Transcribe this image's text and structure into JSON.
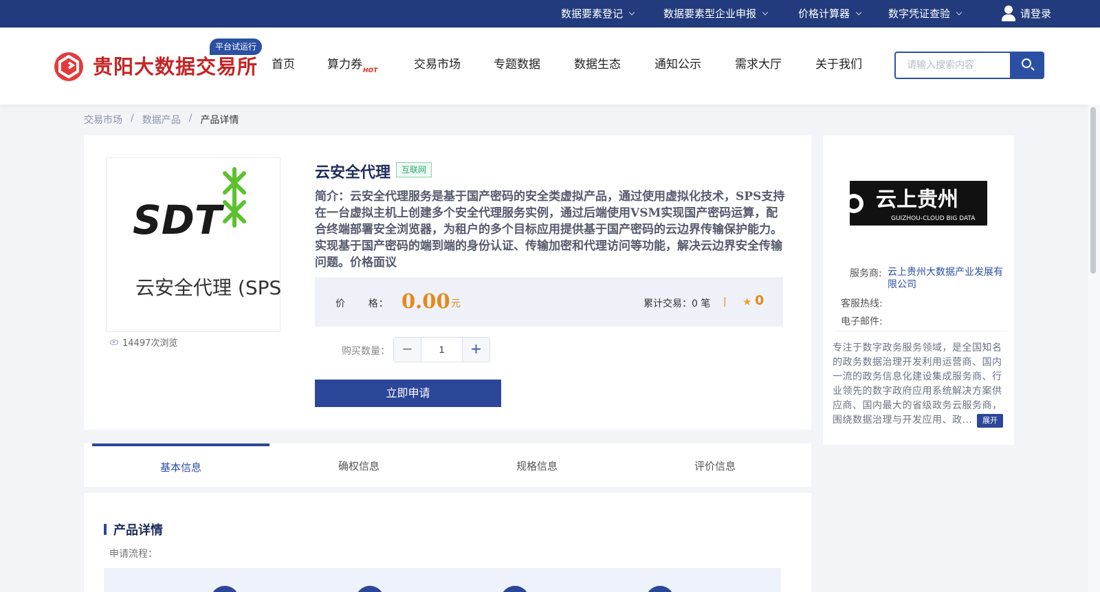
{
  "topbar": {
    "items": [
      {
        "label": "数据要素登记"
      },
      {
        "label": "数据要素型企业申报"
      },
      {
        "label": "价格计算器"
      },
      {
        "label": "数字凭证查验"
      }
    ],
    "login": "请登录"
  },
  "header": {
    "site_name": "贵阳大数据交易所",
    "trial_badge": "平台试运行",
    "nav": [
      {
        "label": "首页"
      },
      {
        "label": "算力券",
        "hot": "HOT"
      },
      {
        "label": "交易市场"
      },
      {
        "label": "专题数据"
      },
      {
        "label": "数据生态"
      },
      {
        "label": "通知公示"
      },
      {
        "label": "需求大厅"
      },
      {
        "label": "关于我们"
      }
    ],
    "search_placeholder": "请输入搜索内容"
  },
  "breadcrumb": {
    "items": [
      "交易市场",
      "数据产品",
      "产品详情"
    ],
    "separator": "/"
  },
  "product": {
    "image_brand": "SDT",
    "image_caption": "云安全代理 (SPS)",
    "views": "14497次浏览",
    "title": "云安全代理",
    "tag": "互联网",
    "description": "简介：云安全代理服务是基于国产密码的安全类虚拟产品，通过使用虚拟化技术，SPS支持在一台虚拟主机上创建多个安全代理服务实例，通过后端使用VSM实现国产密码运算，配合终端部署安全浏览器，为租户的多个目标应用提供基于国产密码的云边界传输保护能力。实现基于国产密码的端到端的身份认证、传输加密和代理访问等功能，解决云边界安全传输问题。价格面议",
    "price_label": "价      格：",
    "price": "0.00",
    "price_unit": "元",
    "trade_count": "累计交易：0 笔",
    "divider": "|",
    "rating": "0",
    "qty_label": "购买数量：",
    "qty_value": "1",
    "minus": "−",
    "plus": "+",
    "apply_label": "立即申请"
  },
  "vendor": {
    "logo_text": "云上贵州",
    "logo_subtext": "GUIZHOU-CLOUD BIG DATA",
    "provider_label": "服务商:",
    "provider_name": "云上贵州大数据产业发展有限公司",
    "hotline_label": "客服热线:",
    "email_label": "电子邮件:",
    "description": "专注于数字政务服务领域，是全国知名的政务数据治理开发利用运营商、国内一流的政务信息化建设集成服务商、行业领先的数字政府应用系统解决方案供应商、国内最大的省级政务云服务商，围绕数据治理与开发应用、政...",
    "expand_label": "展开"
  },
  "tabs": [
    {
      "label": "基本信息",
      "active": true
    },
    {
      "label": "确权信息"
    },
    {
      "label": "规格信息"
    },
    {
      "label": "评价信息"
    }
  ],
  "detail": {
    "section_title": "产品详情",
    "flow_label": "申请流程："
  },
  "colors": {
    "primary": "#2c4699",
    "topbar": "#213b7c",
    "price": "#e48a1b",
    "brand_red": "#c62424"
  }
}
